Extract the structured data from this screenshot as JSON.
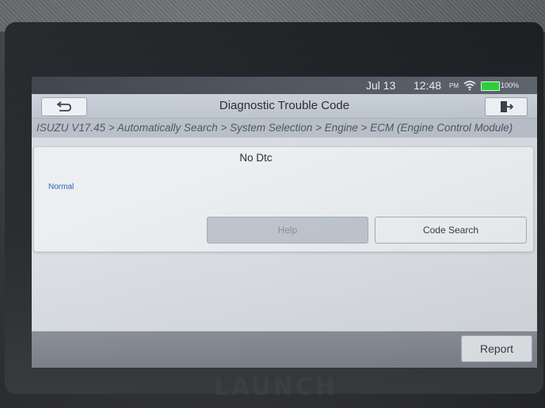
{
  "status_bar": {
    "date": "Jul 13",
    "time": "12:48",
    "ampm": "PM",
    "battery": "100%",
    "battery_color": "#2ecf3a",
    "wifi_icon": "wifi-icon"
  },
  "header": {
    "title": "Diagnostic Trouble Code",
    "back_icon": "back-arrow-icon",
    "exit_icon": "exit-icon"
  },
  "breadcrumb": "ISUZU V17.45 > Automatically Search > System Selection > Engine > ECM (Engine Control Module)",
  "panel": {
    "title": "No Dtc",
    "status": "Normal",
    "status_color": "#2b5fb8",
    "help_label": "Help",
    "code_search_label": "Code Search"
  },
  "footer": {
    "report_label": "Report"
  },
  "brand": "LAUNCH"
}
